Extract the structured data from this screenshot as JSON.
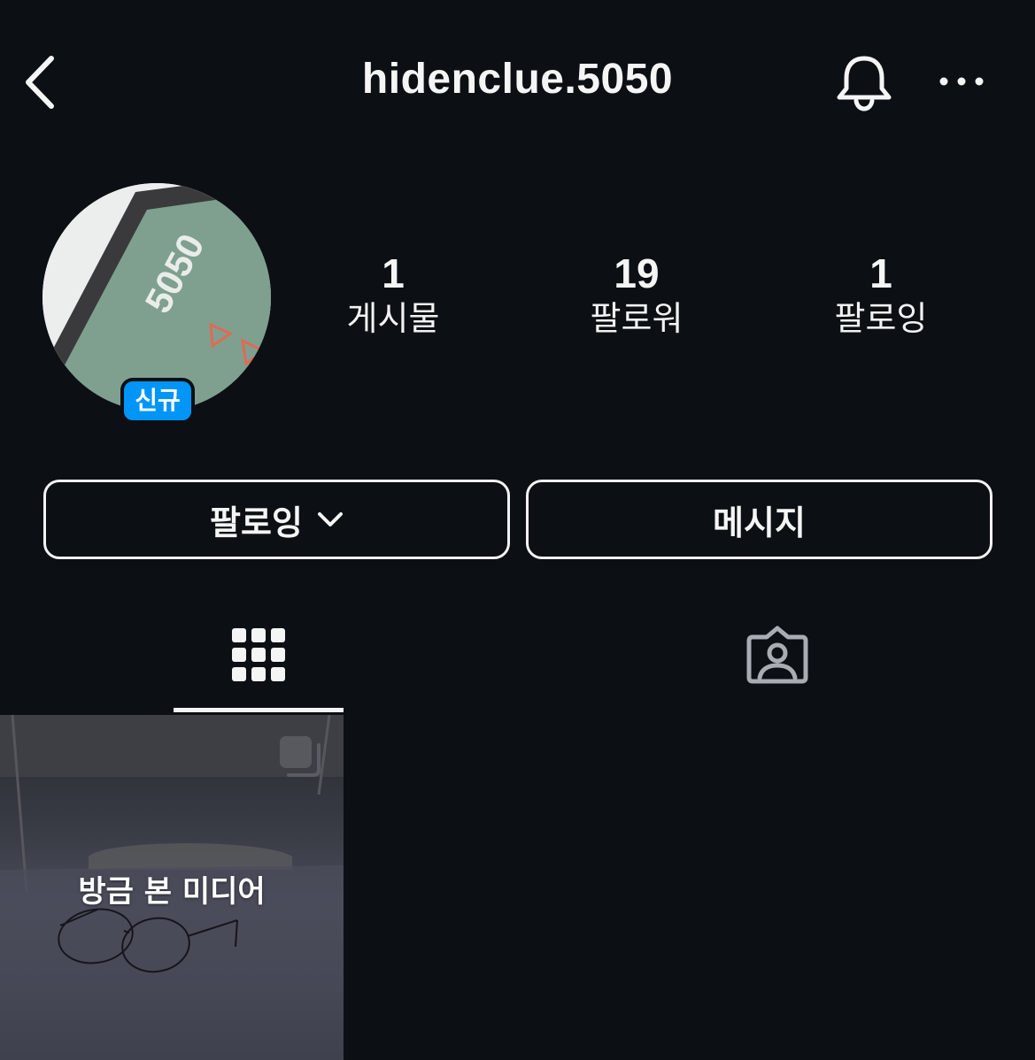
{
  "header": {
    "username": "hidenclue.5050"
  },
  "profile": {
    "avatar_text": "5050",
    "badge": "신규"
  },
  "stats": [
    {
      "value": "1",
      "label": "게시물"
    },
    {
      "value": "19",
      "label": "팔로워"
    },
    {
      "value": "1",
      "label": "팔로잉"
    }
  ],
  "actions": {
    "following_label": "팔로잉",
    "message_label": "메시지"
  },
  "tabs": [
    {
      "icon": "grid-icon",
      "active": true
    },
    {
      "icon": "tagged-icon",
      "active": false
    }
  ],
  "posts": [
    {
      "caption": "방금 본 미디어",
      "type": "carousel"
    }
  ],
  "colors": {
    "background": "#0c1014",
    "badge": "#0095f6",
    "text": "#f5f5f5"
  }
}
